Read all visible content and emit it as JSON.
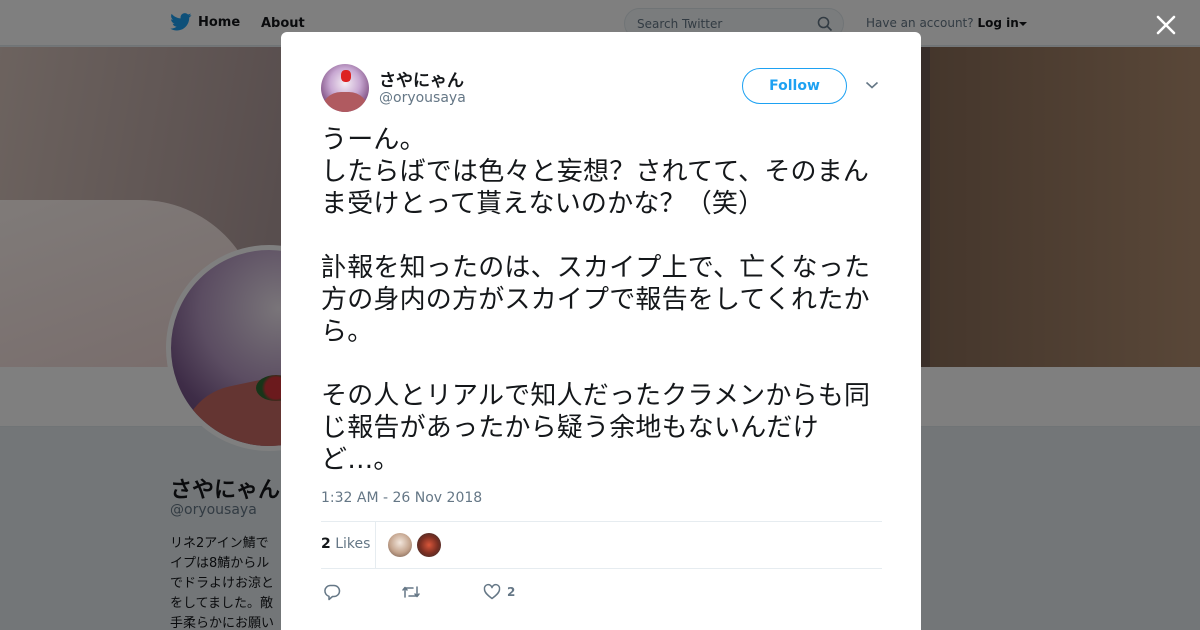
{
  "nav": {
    "home_label": "Home",
    "about_label": "About",
    "search_placeholder": "Search Twitter",
    "account_prompt": "Have an account?",
    "login_label": "Log in"
  },
  "background_profile": {
    "name": "さやにゃん",
    "handle": "@oryousaya",
    "bio_lines": [
      "リネ2アイン鯖で",
      "イプは8鯖からル",
      "でドラよけお涼と",
      "をしてました。敵",
      "手柔らかにお願い"
    ]
  },
  "tweet": {
    "display_name": "さやにゃん",
    "screen_name": "@oryousaya",
    "follow_label": "Follow",
    "text": "うーん。\nしたらばでは色々と妄想？されてて、そのまんま受けとって貰えないのかな？（笑）\n\n訃報を知ったのは、スカイプ上で、亡くなった方の身内の方がスカイプで報告をしてくれたから。\n\nその人とリアルで知人だったクラメンからも同じ報告があったから疑う余地もないんだけど…。",
    "timestamp": "1:32 AM - 26 Nov 2018",
    "likes_count": "2",
    "likes_label": "Likes",
    "like_action_count": "2"
  },
  "colors": {
    "twitter_blue": "#1da1f2",
    "text_primary": "#14171a",
    "text_secondary": "#657786"
  },
  "icons": [
    "twitter-bird-icon",
    "search-icon",
    "caret-down-icon",
    "close-icon",
    "chevron-down-icon",
    "reply-icon",
    "retweet-icon",
    "heart-icon"
  ]
}
